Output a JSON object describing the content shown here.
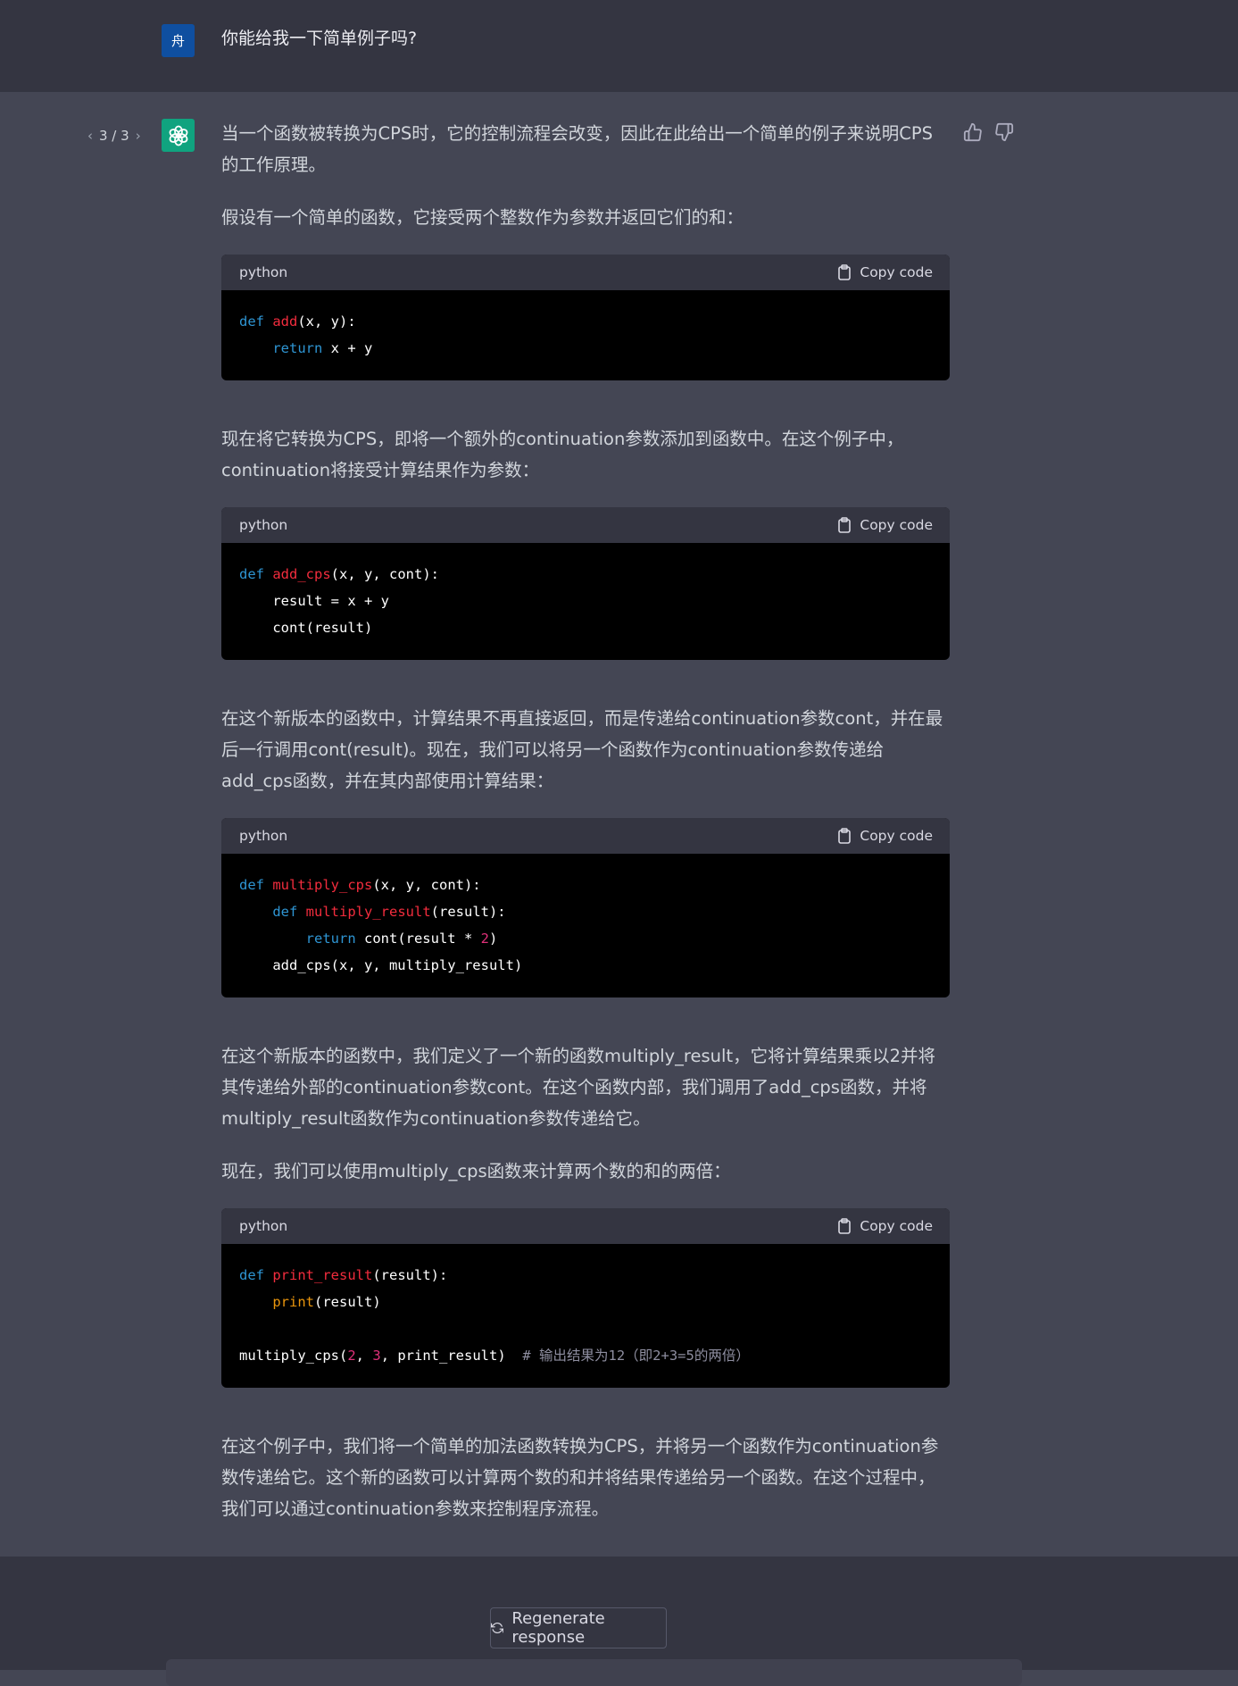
{
  "user_message": {
    "avatar_letter": "舟",
    "text": "你能给我一下简单例子吗?"
  },
  "assistant": {
    "pager": {
      "prev": "‹",
      "label": "3 / 3",
      "next": "›"
    },
    "paragraphs": [
      "当一个函数被转换为CPS时，它的控制流程会改变，因此在此给出一个简单的例子来说明CPS的工作原理。",
      "假设有一个简单的函数，它接受两个整数作为参数并返回它们的和：",
      "现在将它转换为CPS，即将一个额外的continuation参数添加到函数中。在这个例子中，continuation将接受计算结果作为参数：",
      "在这个新版本的函数中，计算结果不再直接返回，而是传递给continuation参数cont，并在最后一行调用cont(result)。现在，我们可以将另一个函数作为continuation参数传递给add_cps函数，并在其内部使用计算结果：",
      "在这个新版本的函数中，我们定义了一个新的函数multiply_result，它将计算结果乘以2并将其传递给外部的continuation参数cont。在这个函数内部，我们调用了add_cps函数，并将multiply_result函数作为continuation参数传递给它。",
      "现在，我们可以使用multiply_cps函数来计算两个数的和的两倍：",
      "在这个例子中，我们将一个简单的加法函数转换为CPS，并将另一个函数作为continuation参数传递给它。这个新的函数可以计算两个数的和并将结果传递给另一个函数。在这个过程中，我们可以通过continuation参数来控制程序流程。"
    ],
    "code_blocks": [
      {
        "lang": "python",
        "copy_label": "Copy code"
      },
      {
        "lang": "python",
        "copy_label": "Copy code"
      },
      {
        "lang": "python",
        "copy_label": "Copy code"
      },
      {
        "lang": "python",
        "copy_label": "Copy code"
      }
    ],
    "code": {
      "b1": {
        "def": "def",
        "name": "add",
        "sig": "(x, y):",
        "ret": "return",
        "expr": " x + y"
      },
      "b2": {
        "def": "def",
        "name": "add_cps",
        "sig": "(x, y, cont):",
        "l2": "result = x + y",
        "l3": "cont(result)"
      },
      "b3": {
        "def": "def",
        "name": "multiply_cps",
        "sig": "(x, y, cont):",
        "inner_def": "def",
        "inner_name": "multiply_result",
        "inner_sig": "(result):",
        "ret": "return",
        "ret_pre": " cont(result * ",
        "num": "2",
        "ret_post": ")",
        "l4": "add_cps(x, y, multiply_result)"
      },
      "b4": {
        "def": "def",
        "name": "print_result",
        "sig": "(result):",
        "print": "print",
        "print_arg": "(result)",
        "call_pre": "multiply_cps(",
        "n1": "2",
        "sep": ", ",
        "n2": "3",
        "call_post": ", print_result)  ",
        "comment": "# 输出结果为12（即2+3=5的两倍）"
      }
    }
  },
  "footer": {
    "regenerate_label": "Regenerate response"
  },
  "colors": {
    "keyword": "#2e95d3",
    "function": "#f22c3d",
    "number": "#df3079",
    "builtin": "#e9950c",
    "comment": "#8e8ea0"
  }
}
